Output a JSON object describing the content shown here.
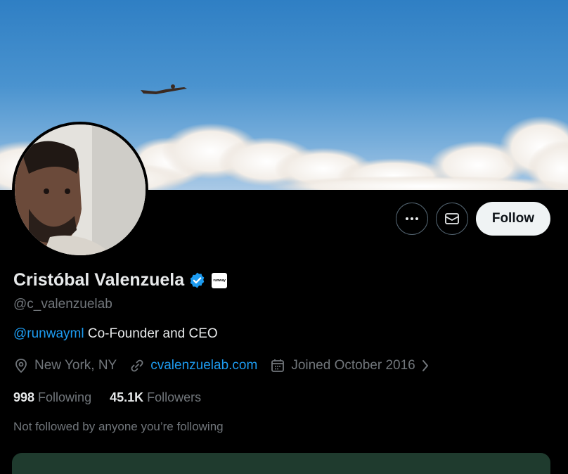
{
  "profile": {
    "name": "Cristóbal Valenzuela",
    "handle": "@c_valenzuelab",
    "affiliate_badge_text": "runway",
    "bio_mention": "@runwayml",
    "bio_text": " Co-Founder and CEO",
    "location": "New York, NY",
    "website": "cvalenzuelab.com",
    "joined": "Joined October 2016",
    "following_count": "998",
    "following_label": "Following",
    "followers_count": "45.1K",
    "followers_label": "Followers",
    "not_followed_note": "Not followed by anyone you’re following"
  },
  "actions": {
    "more_icon": "more-icon",
    "message_icon": "envelope-icon",
    "follow_label": "Follow"
  },
  "colors": {
    "background": "#000000",
    "primary_text": "#e7e9ea",
    "secondary_text": "#71767b",
    "link": "#1d9bf0",
    "follow_button_bg": "#eff3f4",
    "verified": "#1d9bf0"
  }
}
